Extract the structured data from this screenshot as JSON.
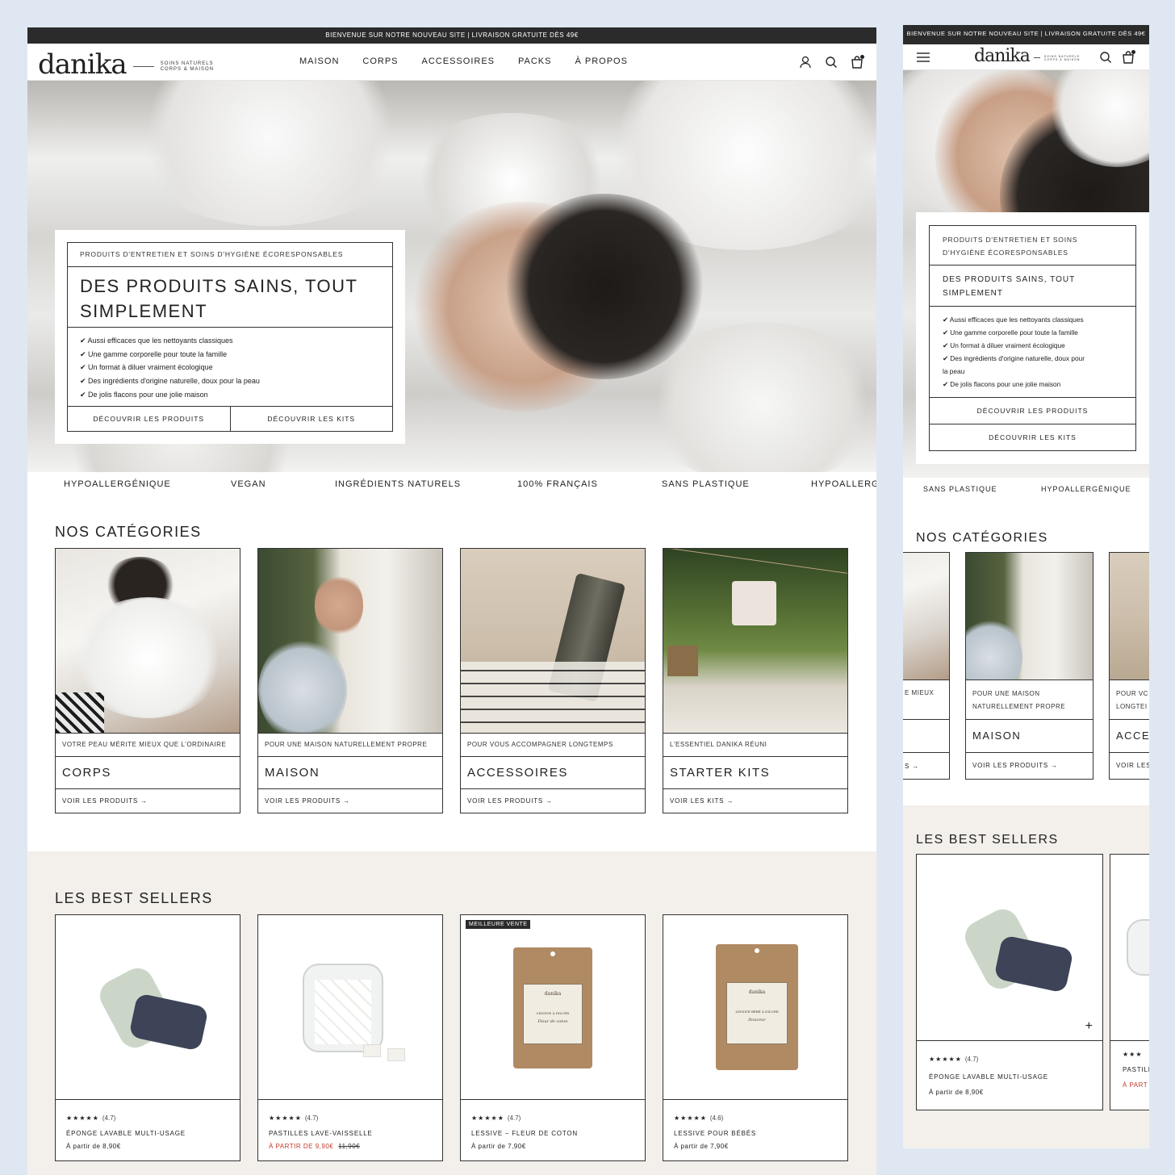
{
  "announcement": "BIENVENUE SUR NOTRE NOUVEAU SITE | LIVRAISON GRATUITE DÈS 49€",
  "logo": {
    "word": "danika",
    "tag_line1": "SOINS NATURELS",
    "tag_line2": "CORPS & MAISON"
  },
  "nav": [
    "MAISON",
    "CORPS",
    "ACCESSOIRES",
    "PACKS",
    "À PROPOS"
  ],
  "hero": {
    "eyebrow": "PRODUITS D'ENTRETIEN ET SOINS D'HYGIÈNE ÉCORESPONSABLES",
    "mobile_eyebrow_line1": "PRODUITS D'ENTRETIEN ET SOINS",
    "mobile_eyebrow_line2": "D'HYGIÈNE ÉCORESPONSABLES",
    "title_line1": "DES PRODUITS SAINS, TOUT",
    "title_line2": "SIMPLEMENT",
    "mobile_title_line1": "DES PRODUITS SAINS, TOUT",
    "mobile_title_line2": "SIMPLEMENT",
    "bullets": [
      "✔ Aussi efficaces que les nettoyants classiques",
      "✔ Une gamme corporelle pour toute la famille",
      "✔ Un format à diluer vraiment écologique",
      "✔ Des ingrédients d'origine naturelle, doux pour la peau",
      "✔ De jolis flacons pour une jolie maison"
    ],
    "mobile_bullets": [
      "✔ Aussi efficaces que les nettoyants classiques",
      "✔ Une gamme corporelle pour toute la famille",
      "✔ Un format à diluer vraiment écologique",
      "✔ Des ingrédients d'origine naturelle, doux pour",
      "la peau",
      "✔ De jolis flacons pour une jolie maison"
    ],
    "btn_products": "DÉCOUVRIR LES PRODUITS",
    "btn_kits": "DÉCOUVRIR LES KITS"
  },
  "marquee": [
    "HYPOALLERGÉNIQUE",
    "VEGAN",
    "INGRÉDIENTS NATURELS",
    "100% FRANÇAIS",
    "SANS PLASTIQUE",
    "HYPOALLERGÉ"
  ],
  "mobile_marquee": [
    "SANS PLASTIQUE",
    "HYPOALLERGÉNIQUE"
  ],
  "categories_title": "NOS CATÉGORIES",
  "categories": [
    {
      "sub": "VOTRE PEAU MÉRITE MIEUX QUE L'ORDINAIRE",
      "name": "CORPS",
      "link": "VOIR LES PRODUITS →"
    },
    {
      "sub": "POUR UNE MAISON NATURELLEMENT PROPRE",
      "name": "MAISON",
      "link": "VOIR LES PRODUITS →"
    },
    {
      "sub": "POUR VOUS ACCOMPAGNER LONGTEMPS",
      "name": "ACCESSOIRES",
      "link": "VOIR LES PRODUITS →"
    },
    {
      "sub": "L'ESSENTIEL DANIKA RÉUNI",
      "name": "STARTER KITS",
      "link": "VOIR LES KITS →"
    }
  ],
  "mobile_categories": {
    "left_sub": "E MIEUX",
    "left_link": "S →",
    "center_sub_line1": "POUR UNE MAISON",
    "center_sub_line2": "NATURELLEMENT PROPRE",
    "center_name": "MAISON",
    "center_link": "VOIR LES PRODUITS →",
    "right_sub_line1": "POUR VC",
    "right_sub_line2": "LONGTEI",
    "right_name": "ACCE",
    "right_link": "VOIR LES"
  },
  "bestsellers_title": "LES BEST SELLERS",
  "products": [
    {
      "stars": "★★★★★",
      "reviews": "(4.7)",
      "name": "ÉPONGE LAVABLE MULTI-USAGE",
      "price": "À partir de 8,90€",
      "sale": false,
      "old_price": "",
      "badge": ""
    },
    {
      "stars": "★★★★★",
      "reviews": "(4.7)",
      "name": "PASTILLES LAVE-VAISSELLE",
      "price": "À PARTIR DE 9,90€",
      "sale": true,
      "old_price": "11,90€",
      "badge": ""
    },
    {
      "stars": "★★★★★",
      "reviews": "(4.7)",
      "name": "LESSIVE – FLEUR DE COTON",
      "price": "À partir de 7,90€",
      "sale": false,
      "old_price": "",
      "badge": "MEILLEURE VENTE"
    },
    {
      "stars": "★★★★★",
      "reviews": "(4.6)",
      "name": "LESSIVE POUR BÉBÉS",
      "price": "À partir de 7,90€",
      "sale": false,
      "old_price": "",
      "badge": ""
    }
  ],
  "mobile_product": {
    "stars": "★★★★★",
    "reviews": "(4.7)",
    "name": "ÉPONGE LAVABLE MULTI-USAGE",
    "price": "À partir de 8,90€",
    "plus": "+",
    "peek_stars": "★★★",
    "peek_name": "PASTILL",
    "peek_price": "À PART"
  },
  "pouch_labels": [
    {
      "brand": "danika",
      "line1": "LESSIVE À DILUER",
      "line2": "Fleur de coton"
    },
    {
      "brand": "danika",
      "line1": "LESSIVE BÉBÉ À DILUER",
      "line2": "Douceur"
    }
  ],
  "colors": {
    "dark": "#2b2b2b",
    "beige": "#f3f0eb",
    "sale_red": "#c0392b",
    "page_bg": "#dfe8f2"
  }
}
